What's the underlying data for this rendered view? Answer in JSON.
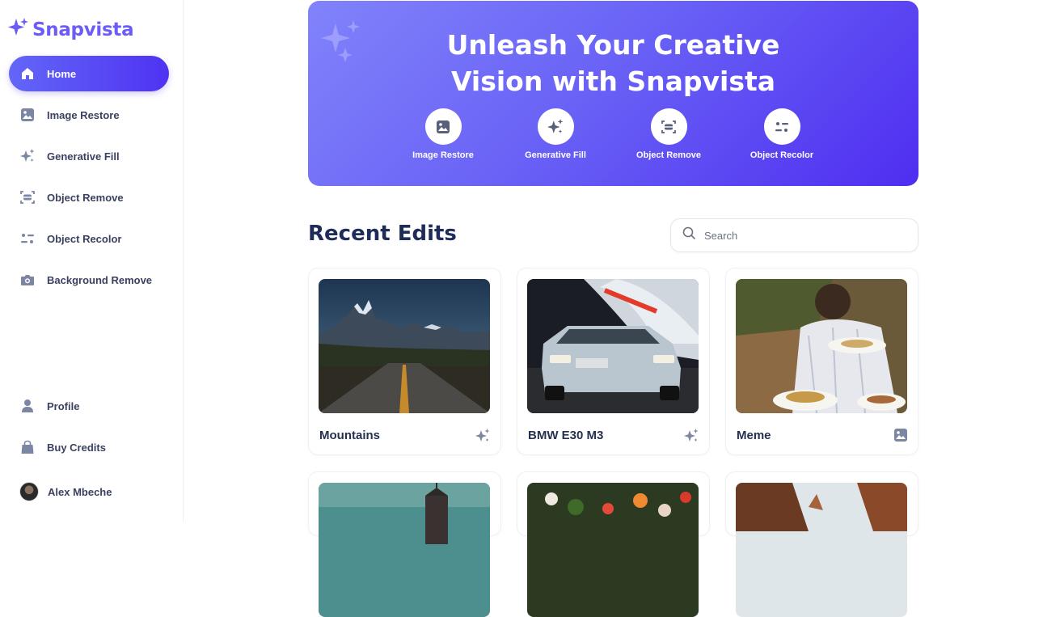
{
  "brand": {
    "name": "Snapvista",
    "accent": "#6c5cf5"
  },
  "sidebar": {
    "items": [
      {
        "label": "Home",
        "icon": "home-icon",
        "active": true
      },
      {
        "label": "Image Restore",
        "icon": "image-icon"
      },
      {
        "label": "Generative Fill",
        "icon": "sparkles-icon"
      },
      {
        "label": "Object Remove",
        "icon": "scan-icon"
      },
      {
        "label": "Object Recolor",
        "icon": "filter-icon"
      },
      {
        "label": "Background Remove",
        "icon": "camera-icon"
      }
    ],
    "bottom": [
      {
        "label": "Profile",
        "icon": "user-icon"
      },
      {
        "label": "Buy Credits",
        "icon": "bag-icon"
      }
    ],
    "user": {
      "name": "Alex Mbeche"
    }
  },
  "hero": {
    "title_line1": "Unleash Your Creative",
    "title_line2": "Vision with Snapvista",
    "tools": [
      {
        "label": "Image Restore",
        "icon": "image-icon"
      },
      {
        "label": "Generative Fill",
        "icon": "sparkles-icon"
      },
      {
        "label": "Object Remove",
        "icon": "scan-icon"
      },
      {
        "label": "Object Recolor",
        "icon": "filter-icon"
      }
    ]
  },
  "recent": {
    "title": "Recent Edits",
    "search_placeholder": "Search",
    "cards": [
      {
        "title": "Mountains",
        "icon": "sparkles-icon"
      },
      {
        "title": "BMW E30 M3",
        "icon": "sparkles-icon"
      },
      {
        "title": "Meme",
        "icon": "image-icon"
      }
    ]
  }
}
